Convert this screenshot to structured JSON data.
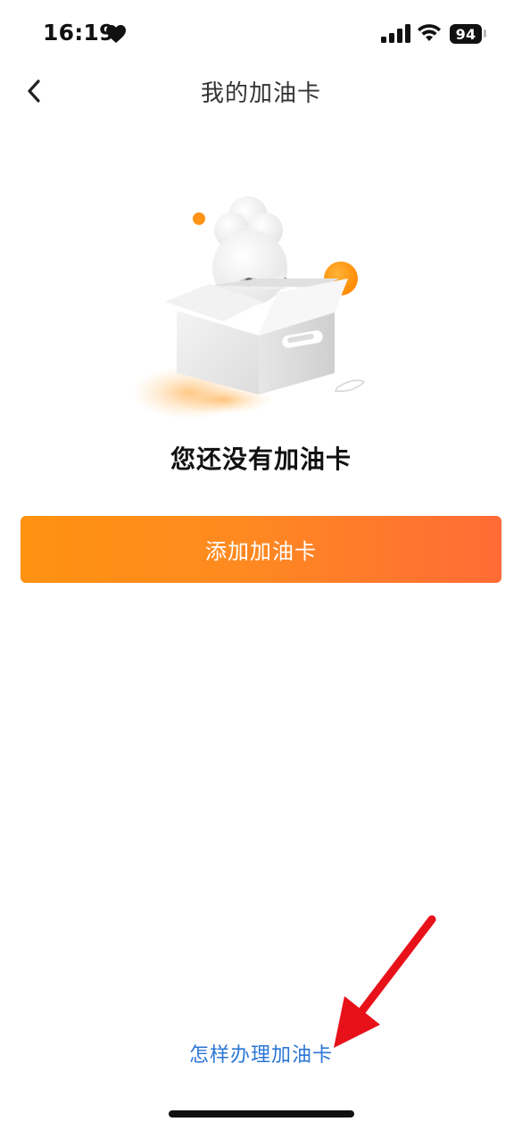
{
  "status_bar": {
    "time": "16:19",
    "battery": "94",
    "icons": [
      "heart-icon",
      "signal-icon",
      "wifi-icon",
      "battery-icon"
    ]
  },
  "nav": {
    "back_icon": "chevron-left-icon",
    "title": "我的加油卡"
  },
  "empty_state": {
    "illustration": "box-with-mascot-illustration",
    "message": "您还没有加油卡"
  },
  "actions": {
    "add_card_label": "添加加油卡",
    "how_to_link": "怎样办理加油卡"
  },
  "colors": {
    "accent_orange": "#ff8a20",
    "accent_orange_end": "#ff6b36",
    "link_blue": "#2b76d6",
    "annotation_red": "#e8111a"
  }
}
